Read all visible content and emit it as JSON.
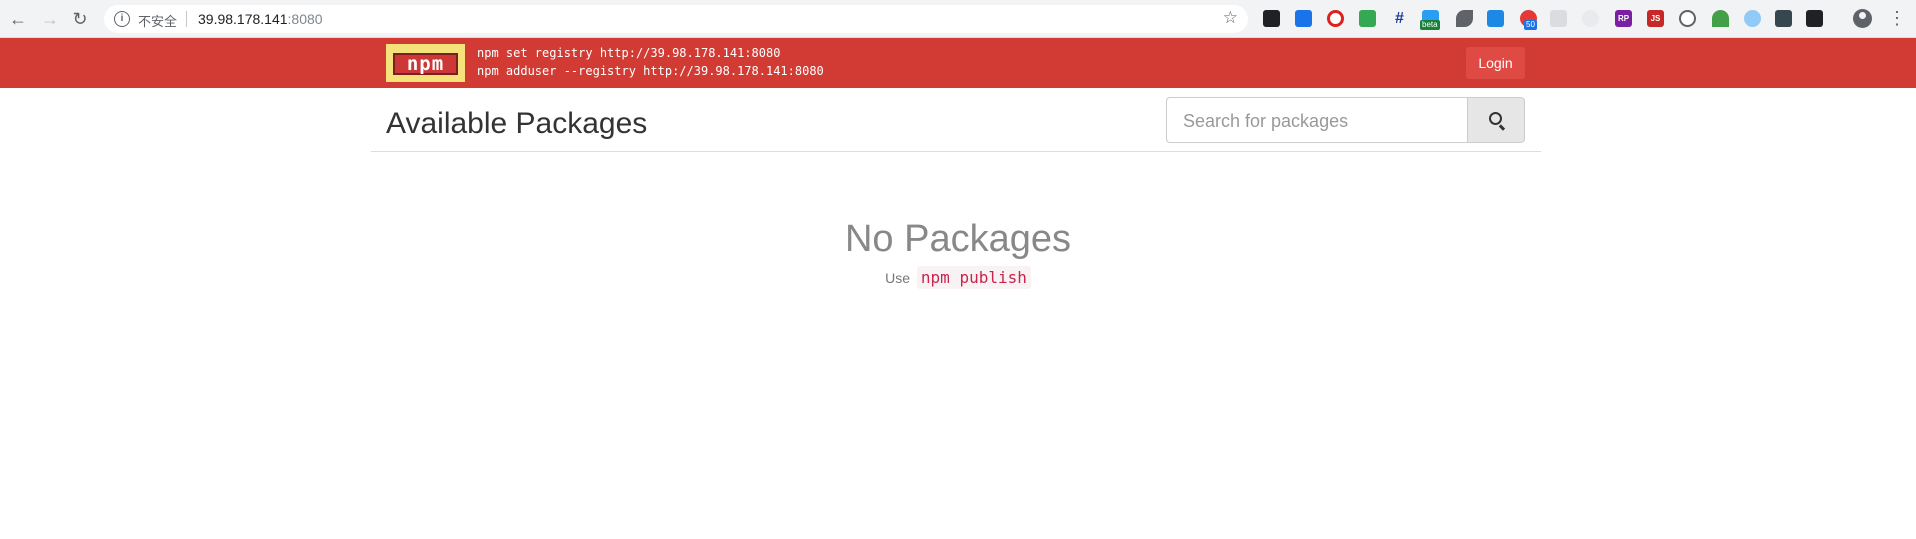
{
  "browser": {
    "security_label": "不安全",
    "url_host": "39.98.178.141",
    "url_port": ":8080",
    "extensions": [
      "extension-icon",
      "extension-icon",
      "extension-icon",
      "extension-icon",
      "extension-icon",
      "extension-icon",
      "extension-icon",
      "extension-icon",
      "extension-icon",
      "extension-icon",
      "extension-icon",
      "extension-icon",
      "extension-icon",
      "extension-icon",
      "extension-icon",
      "extension-icon",
      "extension-icon",
      "extension-icon"
    ],
    "badges": {
      "beta": "beta",
      "count": "50",
      "rp": "RP",
      "js": "JS"
    }
  },
  "header": {
    "logo_text": "npm",
    "command_1": "npm set registry http://39.98.178.141:8080",
    "command_2": "npm adduser --registry http://39.98.178.141:8080",
    "login_label": "Login",
    "brand_color": "#d13b34"
  },
  "main": {
    "title": "Available Packages",
    "search_placeholder": "Search for packages",
    "empty_title": "No Packages",
    "empty_hint_prefix": "Use",
    "empty_hint_code": "npm publish"
  }
}
